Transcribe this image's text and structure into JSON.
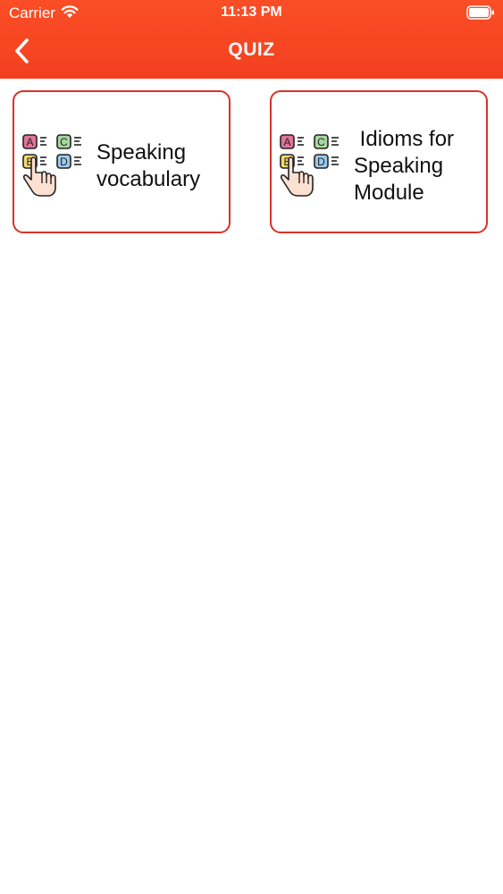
{
  "status_bar": {
    "carrier": "Carrier",
    "time": "11:13 PM"
  },
  "nav": {
    "title": "QUIZ",
    "back_icon": "chevron-left-icon"
  },
  "colors": {
    "header": "#f2401f",
    "card_border": "#d8322a"
  },
  "cards": [
    {
      "label": "Speaking vocabulary",
      "icon": "quiz-abcd-icon"
    },
    {
      "label": " Idioms for Speaking Module",
      "icon": "quiz-abcd-icon"
    }
  ],
  "icon_letters": [
    "A",
    "C",
    "B",
    "D"
  ]
}
